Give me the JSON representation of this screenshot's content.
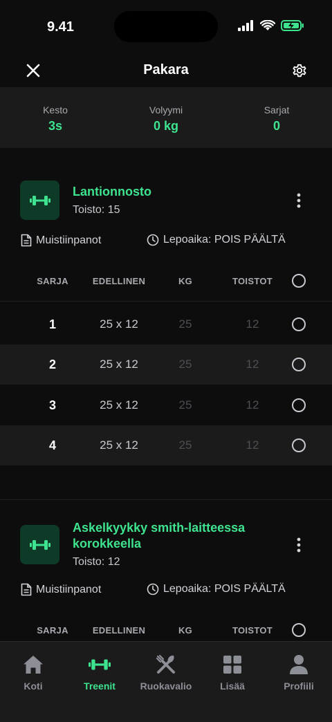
{
  "status_bar": {
    "time": "9.41"
  },
  "header": {
    "title": "Pakara"
  },
  "stats": [
    {
      "label": "Kesto",
      "value": "3s"
    },
    {
      "label": "Volyymi",
      "value": "0 kg"
    },
    {
      "label": "Sarjat",
      "value": "0"
    }
  ],
  "columns": {
    "set": "SARJA",
    "previous": "EDELLINEN",
    "weight": "KG",
    "reps": "TOISTOT"
  },
  "exercises": [
    {
      "name": "Lantionnosto",
      "reps": "Toisto: 15",
      "notes_label": "Muistiinpanot",
      "rest_label": "Lepoaika: POIS PÄÄLTÄ",
      "sets": [
        {
          "num": "1",
          "previous": "25 x 12",
          "weight": "25",
          "reps": "12"
        },
        {
          "num": "2",
          "previous": "25 x 12",
          "weight": "25",
          "reps": "12"
        },
        {
          "num": "3",
          "previous": "25 x 12",
          "weight": "25",
          "reps": "12"
        },
        {
          "num": "4",
          "previous": "25 x 12",
          "weight": "25",
          "reps": "12"
        }
      ]
    },
    {
      "name": "Askelkyykky smith-laitteessa korokkeella",
      "reps": "Toisto: 12",
      "notes_label": "Muistiinpanot",
      "rest_label": "Lepoaika: POIS PÄÄLTÄ"
    }
  ],
  "tabs": [
    {
      "label": "Koti",
      "icon": "home-icon"
    },
    {
      "label": "Treenit",
      "icon": "dumbbell-icon",
      "active": true
    },
    {
      "label": "Ruokavalio",
      "icon": "utensils-icon"
    },
    {
      "label": "Lisää",
      "icon": "grid-icon"
    },
    {
      "label": "Profiili",
      "icon": "user-icon"
    }
  ],
  "colors": {
    "accent": "#3ee38f",
    "background": "#0d0d0d",
    "surface": "#1b1b1b",
    "icon_tile": "#0e3a28"
  }
}
